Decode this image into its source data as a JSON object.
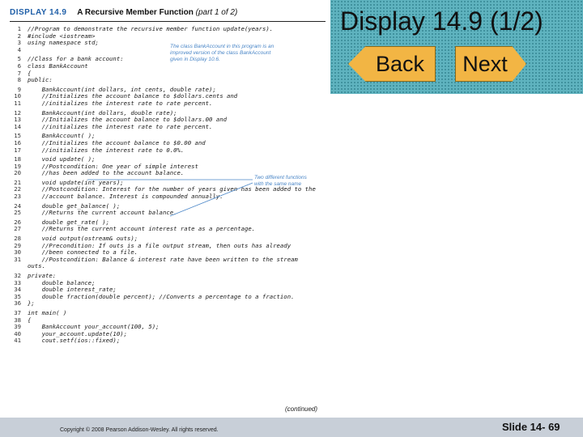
{
  "slide": {
    "title": "Display 14.9 (1/2)",
    "nav": {
      "back_label": "Back",
      "next_label": "Next"
    },
    "footer": {
      "copyright": "Copyright © 2008 Pearson Addison-Wesley. All rights reserved.",
      "slide_number": "Slide 14- 69"
    },
    "colors": {
      "title_panel": "#5fb3bf",
      "nav_button": "#f2b544",
      "footer_bar": "#c8cfd8",
      "annotation": "#4a86c7",
      "display_label": "#1f5fa8"
    }
  },
  "listing": {
    "label": "DISPLAY 14.9",
    "title": "A Recursive Member Function",
    "subtitle": "(part 1 of 2)",
    "annotations": {
      "bankaccount_note": [
        "The class BankAccount in this program is an",
        "improved version of the class BankAccount",
        "given in Display 10.6."
      ],
      "functions_note": [
        "Two different functions",
        "with the same name"
      ]
    },
    "continued": "(continued)",
    "lines": [
      {
        "n": "1",
        "text": "//Program to demonstrate the recursive member function update(years)."
      },
      {
        "n": "2",
        "text": "#include <iostream>"
      },
      {
        "n": "3",
        "text": "using namespace std;"
      },
      {
        "n": "4",
        "text": ""
      },
      {
        "n": "5",
        "text": "//Class for a bank account:"
      },
      {
        "n": "6",
        "text": "class BankAccount"
      },
      {
        "n": "7",
        "text": "{"
      },
      {
        "n": "8",
        "text": "public:"
      },
      {
        "n": "9",
        "text": "    BankAccount(int dollars, int cents, double rate);"
      },
      {
        "n": "10",
        "text": "    //Initializes the account balance to $dollars.cents and"
      },
      {
        "n": "11",
        "text": "    //initializes the interest rate to rate percent."
      },
      {
        "n": "12",
        "text": "    BankAccount(int dollars, double rate);"
      },
      {
        "n": "13",
        "text": "    //Initializes the account balance to $dollars.00 and"
      },
      {
        "n": "14",
        "text": "    //initializes the interest rate to rate percent."
      },
      {
        "n": "15",
        "text": "    BankAccount( );"
      },
      {
        "n": "16",
        "text": "    //Initializes the account balance to $0.00 and"
      },
      {
        "n": "17",
        "text": "    //initializes the interest rate to 0.0%."
      },
      {
        "n": "18",
        "text": "    void update( );"
      },
      {
        "n": "19",
        "text": "    //Postcondition: One year of simple interest"
      },
      {
        "n": "20",
        "text": "    //has been added to the account balance."
      },
      {
        "n": "21",
        "text": "    void update(int years);"
      },
      {
        "n": "22",
        "text": "    //Postcondition: Interest for the number of years given has been added to the"
      },
      {
        "n": "23",
        "text": "    //account balance. Interest is compounded annually."
      },
      {
        "n": "24",
        "text": "    double get_balance( );"
      },
      {
        "n": "25",
        "text": "    //Returns the current account balance."
      },
      {
        "n": "26",
        "text": "    double get_rate( );"
      },
      {
        "n": "27",
        "text": "    //Returns the current account interest rate as a percentage."
      },
      {
        "n": "28",
        "text": "    void output(ostream& outs);"
      },
      {
        "n": "29",
        "text": "    //Precondition: If outs is a file output stream, then outs has already"
      },
      {
        "n": "30",
        "text": "    //been connected to a file."
      },
      {
        "n": "31",
        "text": "    //Postcondition: Balance & interest rate have been written to the stream"
      },
      {
        "n": "",
        "text": "outs."
      },
      {
        "n": "32",
        "text": "private:"
      },
      {
        "n": "33",
        "text": "    double balance;"
      },
      {
        "n": "34",
        "text": "    double interest_rate;"
      },
      {
        "n": "35",
        "text": "    double fraction(double percent); //Converts a percentage to a fraction."
      },
      {
        "n": "36",
        "text": "};"
      },
      {
        "n": "37",
        "text": "int main( )"
      },
      {
        "n": "38",
        "text": "{"
      },
      {
        "n": "39",
        "text": "    BankAccount your_account(100, 5);"
      },
      {
        "n": "40",
        "text": "    your_account.update(10);"
      },
      {
        "n": "41",
        "text": "    cout.setf(ios::fixed);"
      }
    ]
  }
}
